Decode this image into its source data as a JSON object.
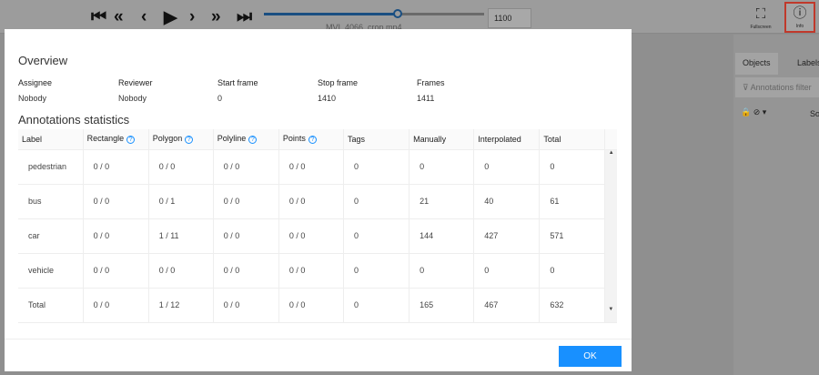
{
  "player": {
    "controls": [
      "first-frame",
      "fast-backward",
      "previous",
      "play",
      "next",
      "fast-forward",
      "last-frame"
    ],
    "progress_frame": 1100,
    "frame_value": "1100",
    "filename": "MVI_4066_crop.mp4"
  },
  "toolbar": {
    "fullscreen_label": "Fullscreen",
    "info_label": "Info"
  },
  "sidebar": {
    "tabs": [
      "Objects",
      "Labels"
    ],
    "filter_placeholder": "Annotations filter",
    "sort_label": "Sort"
  },
  "modal": {
    "overview_title": "Overview",
    "overview": [
      {
        "key": "Assignee",
        "value": "Nobody"
      },
      {
        "key": "Reviewer",
        "value": "Nobody"
      },
      {
        "key": "Start frame",
        "value": "0"
      },
      {
        "key": "Stop frame",
        "value": "1410"
      },
      {
        "key": "Frames",
        "value": "1411"
      }
    ],
    "stats_title": "Annotations statistics",
    "columns": [
      "Label",
      "Rectangle",
      "Polygon",
      "Polyline",
      "Points",
      "Tags",
      "Manually",
      "Interpolated",
      "Total"
    ],
    "rows": [
      [
        "pedestrian",
        "0 / 0",
        "0 / 0",
        "0 / 0",
        "0 / 0",
        "0",
        "0",
        "0",
        "0"
      ],
      [
        "bus",
        "0 / 0",
        "0 / 1",
        "0 / 0",
        "0 / 0",
        "0",
        "21",
        "40",
        "61"
      ],
      [
        "car",
        "0 / 0",
        "1 / 11",
        "0 / 0",
        "0 / 0",
        "0",
        "144",
        "427",
        "571"
      ],
      [
        "vehicle",
        "0 / 0",
        "0 / 0",
        "0 / 0",
        "0 / 0",
        "0",
        "0",
        "0",
        "0"
      ],
      [
        "Total",
        "0 / 0",
        "1 / 12",
        "0 / 0",
        "0 / 0",
        "0",
        "165",
        "467",
        "632"
      ]
    ],
    "ok_label": "OK"
  },
  "colors": {
    "accent": "#1890ff",
    "highlight": "#c0392b"
  }
}
